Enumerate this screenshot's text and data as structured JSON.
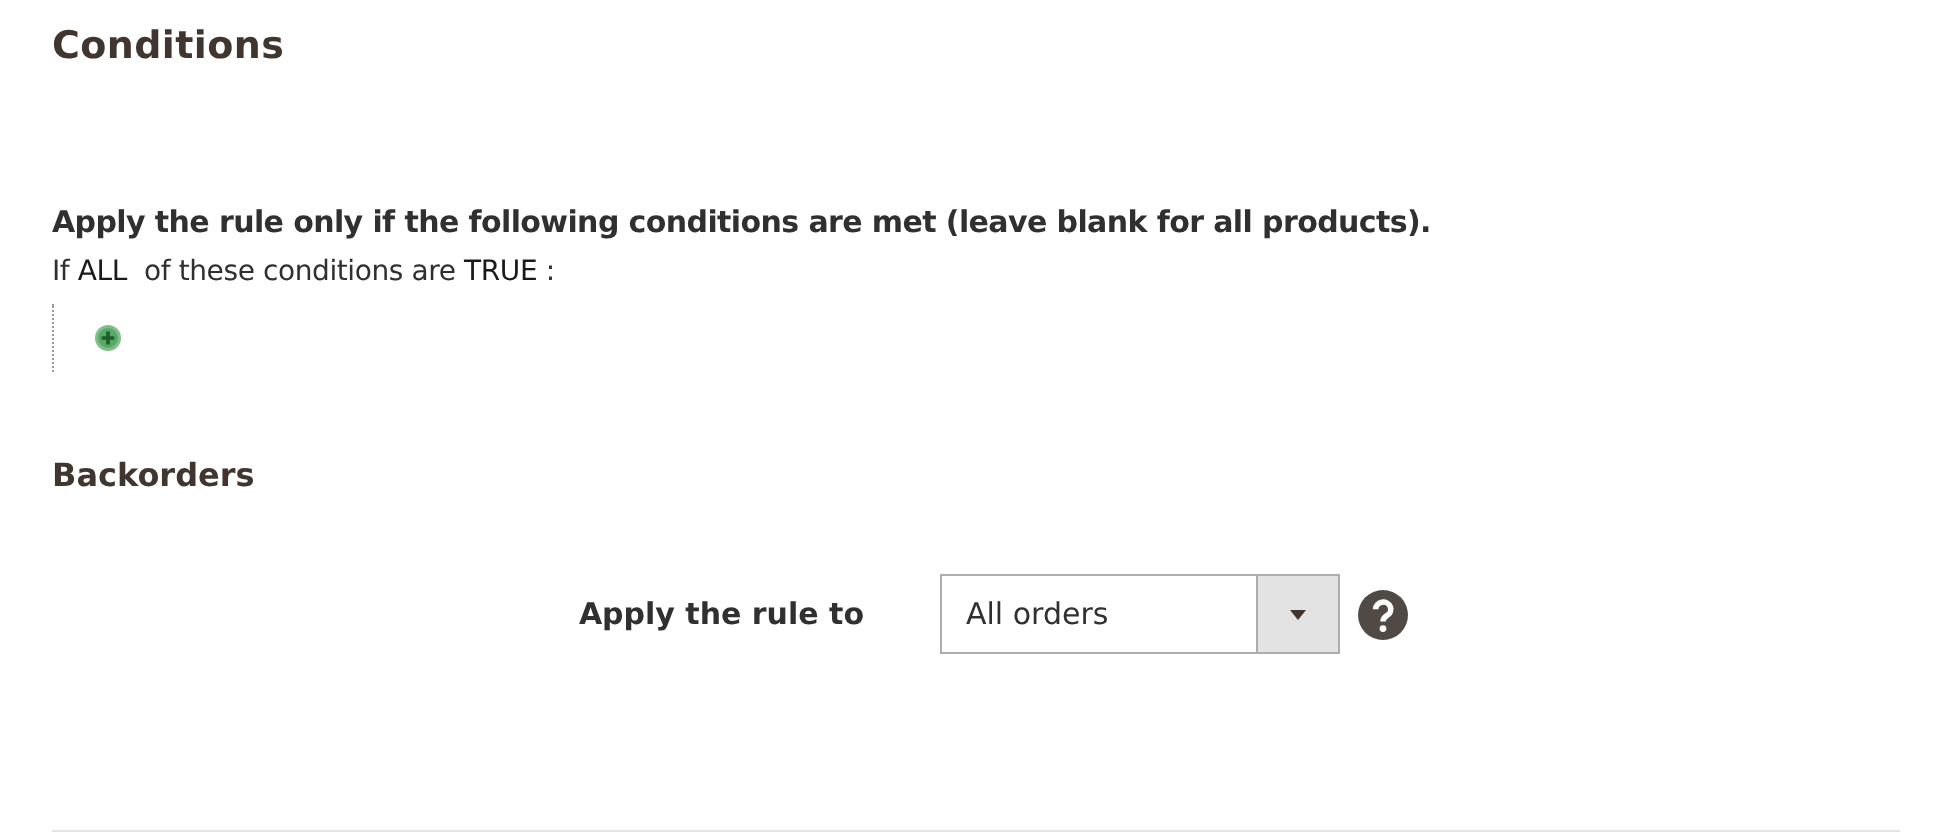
{
  "section_title": "Conditions",
  "conditions": {
    "heading": "Apply the rule only if the following conditions are met (leave blank for all products).",
    "prefix": "If",
    "aggregator": "ALL",
    "middle": "of these conditions are",
    "value": "TRUE",
    "suffix": ":"
  },
  "backorders": {
    "title": "Backorders",
    "field": {
      "label": "Apply the rule to",
      "value": "All orders"
    }
  }
}
